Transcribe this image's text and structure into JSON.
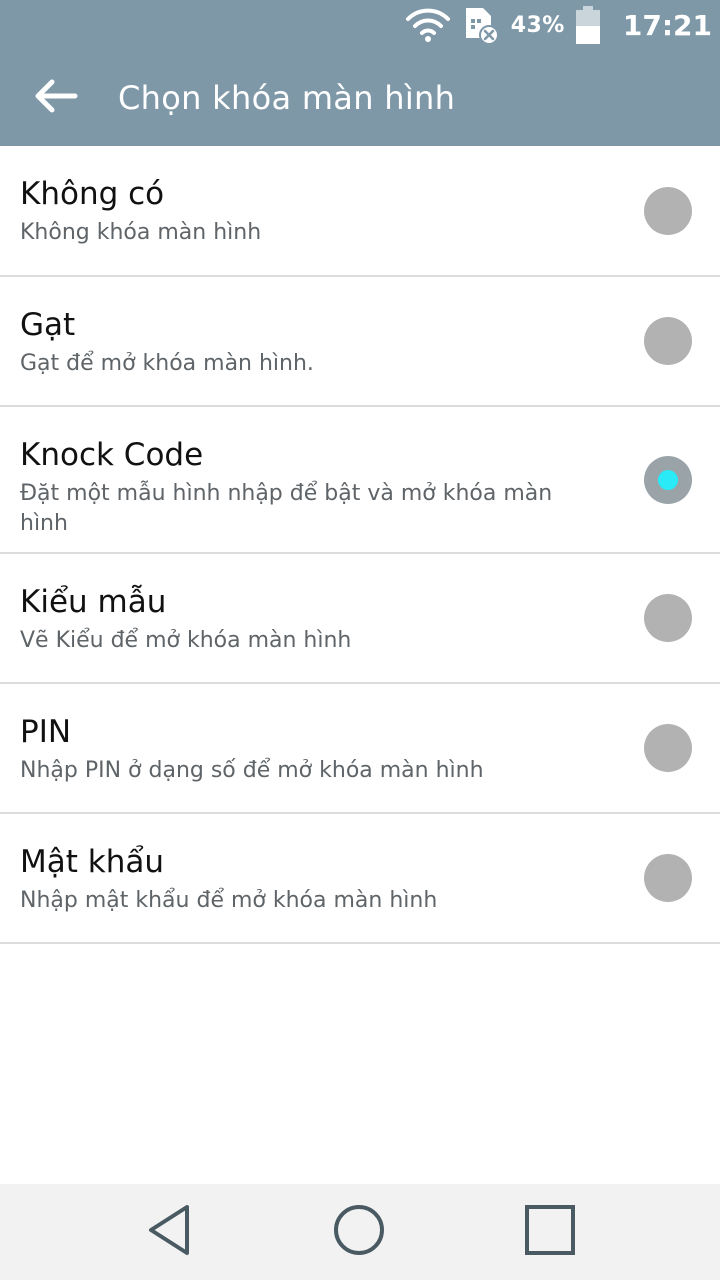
{
  "status_bar": {
    "battery_percent": "43%",
    "time": "17:21",
    "icons": [
      "wifi-icon",
      "sim-no-service-icon",
      "battery-icon"
    ]
  },
  "app_bar": {
    "title": "Chọn khóa màn hình",
    "back_icon": "arrow-left-icon"
  },
  "options": [
    {
      "title": "Không có",
      "subtitle": "Không khóa màn hình",
      "selected": false
    },
    {
      "title": "Gạt",
      "subtitle": "Gạt để mở khóa màn hình.",
      "selected": false
    },
    {
      "title": "Knock Code",
      "subtitle": "Đặt một mẫu hình nhập để bật và mở khóa màn hình",
      "selected": true
    },
    {
      "title": "Kiểu mẫu",
      "subtitle": "Vẽ Kiểu để mở khóa màn hình",
      "selected": false
    },
    {
      "title": "PIN",
      "subtitle": "Nhập PIN ở dạng số để mở khóa màn hình",
      "selected": false
    },
    {
      "title": "Mật khẩu",
      "subtitle": "Nhập mật khẩu để mở khóa màn hình",
      "selected": false
    }
  ],
  "colors": {
    "app_bar": "#7f98a8",
    "radio_off": "#b2b2b2",
    "radio_selected_dot": "#29eaf6"
  },
  "nav_bar": {
    "icons": [
      "back-triangle-icon",
      "home-circle-icon",
      "recent-apps-square-icon"
    ]
  }
}
